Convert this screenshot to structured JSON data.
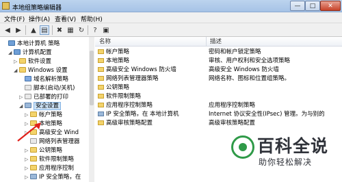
{
  "window": {
    "title": "本地组策略编辑器",
    "buttons": {
      "minimize": "—",
      "maximize": "□",
      "close": "✕"
    }
  },
  "menu": [
    "文件(F)",
    "操作(A)",
    "查看(V)",
    "帮助(H)"
  ],
  "toolbar": {
    "buttons": [
      {
        "name": "back-icon",
        "glyph": "◀"
      },
      {
        "name": "forward-icon",
        "glyph": "▶"
      },
      {
        "name": "up-folder-icon",
        "glyph": "▲"
      },
      {
        "name": "show-hide-tree-icon",
        "glyph": "▤"
      },
      {
        "name": "delete-icon",
        "glyph": "✖"
      },
      {
        "name": "properties-icon",
        "glyph": "▦"
      },
      {
        "name": "refresh-icon",
        "glyph": "↻"
      },
      {
        "name": "help-icon",
        "glyph": "?"
      },
      {
        "name": "mmc-icon",
        "glyph": "▣"
      }
    ]
  },
  "tree": [
    {
      "label": "本地计算机 策略",
      "icon": "computer",
      "twisty": ""
    },
    {
      "label": "计算机配置",
      "icon": "computer",
      "twisty": "◢"
    },
    {
      "label": "软件设置",
      "icon": "folder",
      "twisty": "▷"
    },
    {
      "label": "Windows 设置",
      "icon": "folder",
      "twisty": "◢"
    },
    {
      "label": "域名解析策略",
      "icon": "policy",
      "twisty": ""
    },
    {
      "label": "脚本(启动/关机)",
      "icon": "doc",
      "twisty": ""
    },
    {
      "label": "已部署的打印",
      "icon": "doc",
      "twisty": "▷"
    },
    {
      "label": "安全设置",
      "icon": "shield",
      "twisty": "◢",
      "selected": true
    },
    {
      "label": "帐户策略",
      "icon": "folder",
      "twisty": "▷"
    },
    {
      "label": "本地策略",
      "icon": "folder",
      "twisty": "▷"
    },
    {
      "label": "高级安全 Wind",
      "icon": "folder",
      "twisty": "▷"
    },
    {
      "label": "网络列表管理器",
      "icon": "doc",
      "twisty": ""
    },
    {
      "label": "公钥策略",
      "icon": "folder",
      "twisty": "▷"
    },
    {
      "label": "软件限制策略",
      "icon": "folder",
      "twisty": "▷"
    },
    {
      "label": "应用程序控制",
      "icon": "folder",
      "twisty": "▷"
    },
    {
      "label": "IP 安全策略，在",
      "icon": "shield",
      "twisty": "▷"
    }
  ],
  "list": {
    "columns": [
      "名称",
      "描述"
    ],
    "rows": [
      {
        "name": "帐户策略",
        "desc": "密码和帐户锁定策略",
        "icon": "folder"
      },
      {
        "name": "本地策略",
        "desc": "审核、用户权利和安全选项策略",
        "icon": "folder"
      },
      {
        "name": "高级安全 Windows 防火墙",
        "desc": "高级安全 Windows 防火墙",
        "icon": "folder"
      },
      {
        "name": "网络列表管理器策略",
        "desc": "网络名称、图标和位置组策略。",
        "icon": "folder"
      },
      {
        "name": "公钥策略",
        "desc": "",
        "icon": "folder"
      },
      {
        "name": "软件限制策略",
        "desc": "",
        "icon": "folder"
      },
      {
        "name": "应用程序控制策略",
        "desc": "应用程序控制策略",
        "icon": "folder"
      },
      {
        "name": "IP 安全策略，在 本地计算机",
        "desc": "Internet 协议安全性(IPsec) 管理。为与别的",
        "icon": "shield"
      },
      {
        "name": "高级审核策略配置",
        "desc": "高级审核策略配置",
        "icon": "folder"
      }
    ]
  },
  "watermark": {
    "title": "百科全说",
    "subtitle": "助你轻松解决"
  }
}
